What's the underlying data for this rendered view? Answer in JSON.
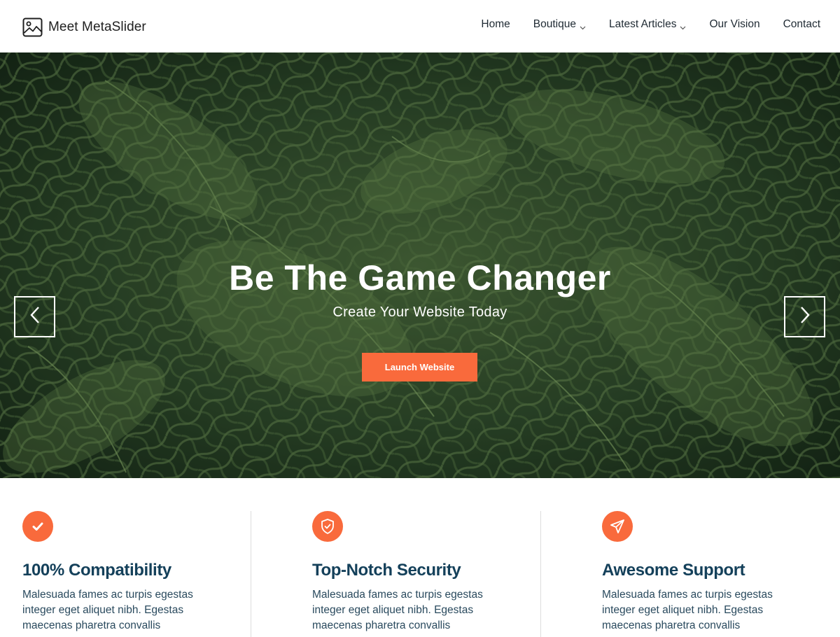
{
  "brand": {
    "name": "Meet MetaSlider",
    "icon": "image-icon"
  },
  "nav": {
    "items": [
      {
        "label": "Home",
        "has_dropdown": false
      },
      {
        "label": "Boutique",
        "has_dropdown": true
      },
      {
        "label": "Latest Articles",
        "has_dropdown": true
      },
      {
        "label": "Our Vision",
        "has_dropdown": false
      },
      {
        "label": "Contact",
        "has_dropdown": false
      }
    ]
  },
  "hero": {
    "title": "Be The Game Changer",
    "subtitle": "Create Your Website Today",
    "cta_label": "Launch Website",
    "slide_count": 3,
    "active_slide": 1,
    "background": "fern leaves photo"
  },
  "features": [
    {
      "icon": "checkmark-icon",
      "title": "100% Compatibility",
      "text": "Malesuada fames ac turpis egestas integer eget aliquet nibh. Egestas maecenas pharetra convallis"
    },
    {
      "icon": "shield-check-icon",
      "title": "Top-Notch Security",
      "text": "Malesuada fames ac turpis egestas integer eget aliquet nibh. Egestas maecenas pharetra convallis"
    },
    {
      "icon": "paper-plane-icon",
      "title": "Awesome Support",
      "text": "Malesuada fames ac turpis egestas integer eget aliquet nibh. Egestas maecenas pharetra convallis"
    }
  ],
  "colors": {
    "accent": "#f96a3c",
    "heading": "#14405a",
    "body_text": "#2a4a5e",
    "hero_green": "#2f4f2a"
  }
}
